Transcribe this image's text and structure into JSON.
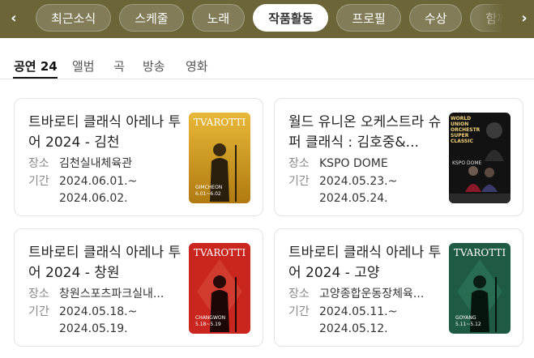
{
  "chips": [
    "최근소식",
    "스케줄",
    "노래",
    "작품활동",
    "프로필",
    "수상",
    "함께 들은 아"
  ],
  "active_chip": 3,
  "nav": {
    "left_glyph": "‹",
    "right_glyph": "›"
  },
  "subtabs": [
    {
      "label": "공연",
      "count": "24"
    },
    {
      "label": "앨범"
    },
    {
      "label": "곡"
    },
    {
      "label": "방송"
    },
    {
      "label": "영화"
    }
  ],
  "labels": {
    "venue": "장소",
    "period": "기간"
  },
  "cards": [
    {
      "title": "트바로티 클래식 아레나 투어 2024 - 김천",
      "venue": "김천실내체육관",
      "start": "2024.06.01.~",
      "end": "2024.06.02.",
      "poster": {
        "text": "TVAROTTI",
        "sub": "GIMCHEON",
        "dates": "6.01~6.02",
        "bg": "#d9a428"
      }
    },
    {
      "title": "월드 유니온 오케스트라 슈퍼 클래식 : 김호중&...",
      "venue": "KSPO DOME",
      "start": "2024.05.23.~",
      "end": "2024.05.24.",
      "poster": {
        "text": "WORLD UNION ORCHESTRA SUPER CLASSIC",
        "sub": "KSPO DOME",
        "bg": "#121212"
      }
    },
    {
      "title": "트바로티 클래식 아레나 투어 2024 - 창원",
      "venue": "창원스포츠파크실내...",
      "start": "2024.05.18.~",
      "end": "2024.05.19.",
      "poster": {
        "text": "TVAROTTI",
        "sub": "CHANGWON",
        "dates": "5.18~5.19",
        "bg": "#c8261e"
      }
    },
    {
      "title": "트바로티 클래식 아레나 투어 2024 - 고양",
      "venue": "고양종합운동장체육...",
      "start": "2024.05.11.~",
      "end": "2024.05.12.",
      "poster": {
        "text": "TVAROTTI",
        "sub": "GOYANG",
        "dates": "5.11~5.12",
        "bg": "#1f5a44"
      }
    }
  ]
}
